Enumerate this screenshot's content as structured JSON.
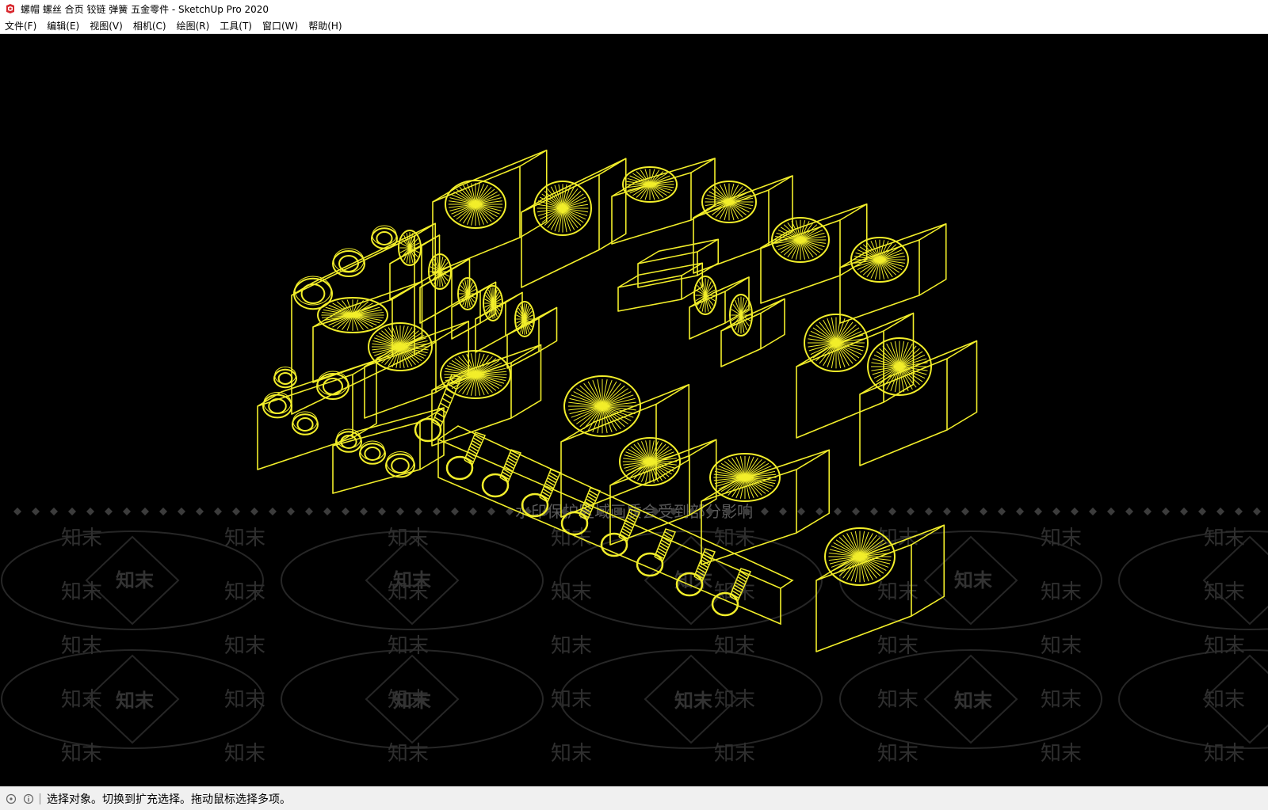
{
  "window": {
    "title": "螺帽 螺丝 合页 铰链 弹簧 五金零件 - SketchUp Pro 2020",
    "app_icon": "sketchup-logo-icon"
  },
  "menu": [
    {
      "label": "文件(F)"
    },
    {
      "label": "编辑(E)"
    },
    {
      "label": "视图(V)"
    },
    {
      "label": "相机(C)"
    },
    {
      "label": "绘图(R)"
    },
    {
      "label": "工具(T)"
    },
    {
      "label": "窗口(W)"
    },
    {
      "label": "帮助(H)"
    }
  ],
  "viewport": {
    "background": "#000000",
    "line_color": "#f2ee2a",
    "watermark_text": "知末",
    "watermark_notice": "水印保护区域画质会受到部分影响"
  },
  "status": {
    "icons": [
      "geo-location-icon",
      "credits-info-icon"
    ],
    "text": "选择对象。切换到扩充选择。拖动鼠标选择多项。"
  }
}
